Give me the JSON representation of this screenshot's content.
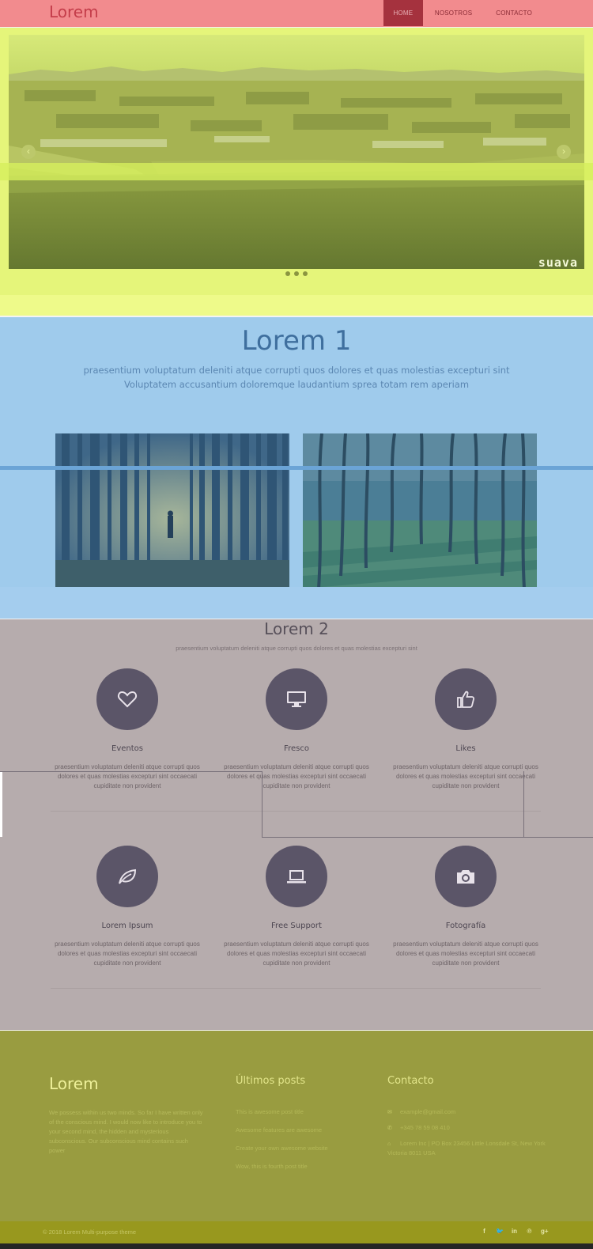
{
  "header": {
    "brand": "Lorem",
    "nav": [
      {
        "label": "HOME",
        "active": true
      },
      {
        "label": "NOSOTROS",
        "active": false
      },
      {
        "label": "CONTACTO",
        "active": false
      }
    ]
  },
  "hero": {
    "image": "aerial-coastal-town",
    "watermark": "suava",
    "slides": 3,
    "prev_icon": "chevron-left-icon",
    "next_icon": "chevron-right-icon"
  },
  "section1": {
    "title": "Lorem 1",
    "subtitle_line1": "praesentium voluptatum deleniti atque corrupti quos dolores et quas molestias excepturi sint",
    "subtitle_line2": "Voluptatem accusantium doloremque laudantium sprea totam rem aperiam",
    "photos": [
      "forest-person-photo",
      "palm-forest-photo"
    ]
  },
  "section2": {
    "title": "Lorem 2",
    "subtitle": "praesentium voluptatum deleniti atque corrupti quos dolores et quas molestias excepturi sint",
    "features": [
      {
        "title": "Eventos",
        "icon": "heart-icon",
        "text": "praesentium voluptatum deleniti atque corrupti quos dolores et quas molestias excepturi sint occaecati cupiditate non provident"
      },
      {
        "title": "Fresco",
        "icon": "monitor-icon",
        "text": "praesentium voluptatum deleniti atque corrupti quos dolores et quas molestias excepturi sint occaecati cupiditate non provident"
      },
      {
        "title": "Likes",
        "icon": "thumbs-up-icon",
        "text": "praesentium voluptatum deleniti atque corrupti quos dolores et quas molestias excepturi sint occaecati cupiditate non provident"
      },
      {
        "title": "Lorem Ipsum",
        "icon": "leaf-icon",
        "text": "praesentium voluptatum deleniti atque corrupti quos dolores et quas molestias excepturi sint occaecati cupiditate non provident"
      },
      {
        "title": "Free Support",
        "icon": "laptop-icon",
        "text": "praesentium voluptatum deleniti atque corrupti quos dolores et quas molestias excepturi sint occaecati cupiditate non provident"
      },
      {
        "title": "Fotografía",
        "icon": "camera-icon",
        "text": "praesentium voluptatum deleniti atque corrupti quos dolores et quas molestias excepturi sint occaecati cupiditate non provident"
      }
    ]
  },
  "footer": {
    "brand": "Lorem",
    "about": "We possess within us two minds. So far I have written only of the conscious mind. I would now like to introduce you to your second mind, the hidden and mysterious subconscious. Our subconscious mind contains such power",
    "posts_heading": "Últimos posts",
    "posts": [
      "This is awesome post title",
      "Awesome features are awesome",
      "Create your own awesome website",
      "Wow, this is fourth post title"
    ],
    "contact_heading": "Contacto",
    "email": "example@gmail.com",
    "phone": "+345 78 59 08 410",
    "address_line1": "Lorem Inc | PO Box 23456 Little Lonsdale St, New York",
    "address_line2": "Victoria 8011 USA",
    "copyright": "© 2018 Lorem Multi-purpose theme",
    "socials": [
      "facebook-icon",
      "twitter-icon",
      "linkedin-icon",
      "pinterest-icon",
      "google-plus-icon"
    ]
  }
}
